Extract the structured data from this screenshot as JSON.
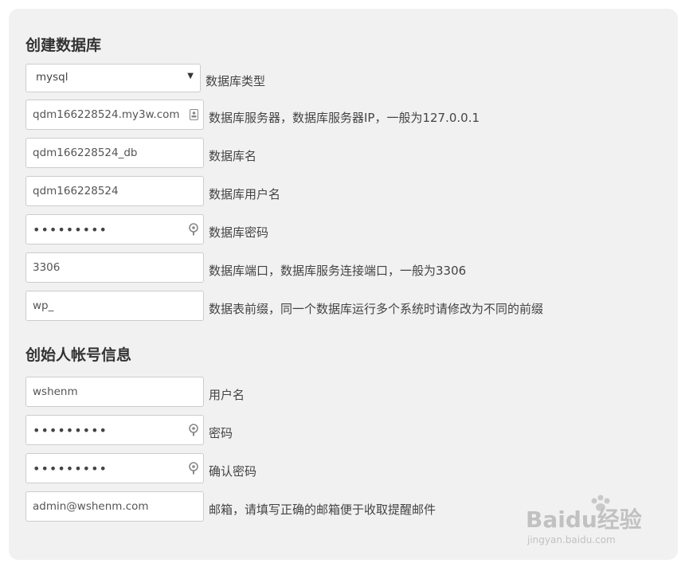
{
  "db_section": {
    "title": "创建数据库",
    "db_type": {
      "value": "mysql",
      "label": "数据库类型"
    },
    "fields": [
      {
        "name": "db-server",
        "value": "qdm166228524.my3w.com",
        "label": "数据库服务器，数据库服务器IP，一般为127.0.0.1",
        "icon": "contact-card-icon",
        "type": "text"
      },
      {
        "name": "db-name",
        "value": "qdm166228524_db",
        "label": "数据库名",
        "type": "text"
      },
      {
        "name": "db-user",
        "value": "qdm166228524",
        "label": "数据库用户名",
        "type": "text"
      },
      {
        "name": "db-password",
        "value": "•••••••••",
        "label": "数据库密码",
        "icon": "key-icon",
        "type": "password"
      },
      {
        "name": "db-port",
        "value": "3306",
        "label": "数据库端口，数据库服务连接端口，一般为3306",
        "type": "text"
      },
      {
        "name": "db-prefix",
        "value": "wp_",
        "label": "数据表前缀，同一个数据库运行多个系统时请修改为不同的前缀",
        "type": "text"
      }
    ]
  },
  "admin_section": {
    "title": "创始人帐号信息",
    "fields": [
      {
        "name": "admin-username",
        "value": "wshenm",
        "label": "用户名",
        "type": "text"
      },
      {
        "name": "admin-password",
        "value": "•••••••••",
        "label": "密码",
        "icon": "key-icon",
        "type": "password"
      },
      {
        "name": "admin-password-confirm",
        "value": "•••••••••",
        "label": "确认密码",
        "icon": "key-icon",
        "type": "password"
      },
      {
        "name": "admin-email",
        "value": "admin@wshenm.com",
        "label": "邮箱，请填写正确的邮箱便于收取提醒邮件",
        "type": "text"
      }
    ]
  },
  "watermark": {
    "brand": "Baidu经验",
    "url": "jingyan.baidu.com"
  }
}
